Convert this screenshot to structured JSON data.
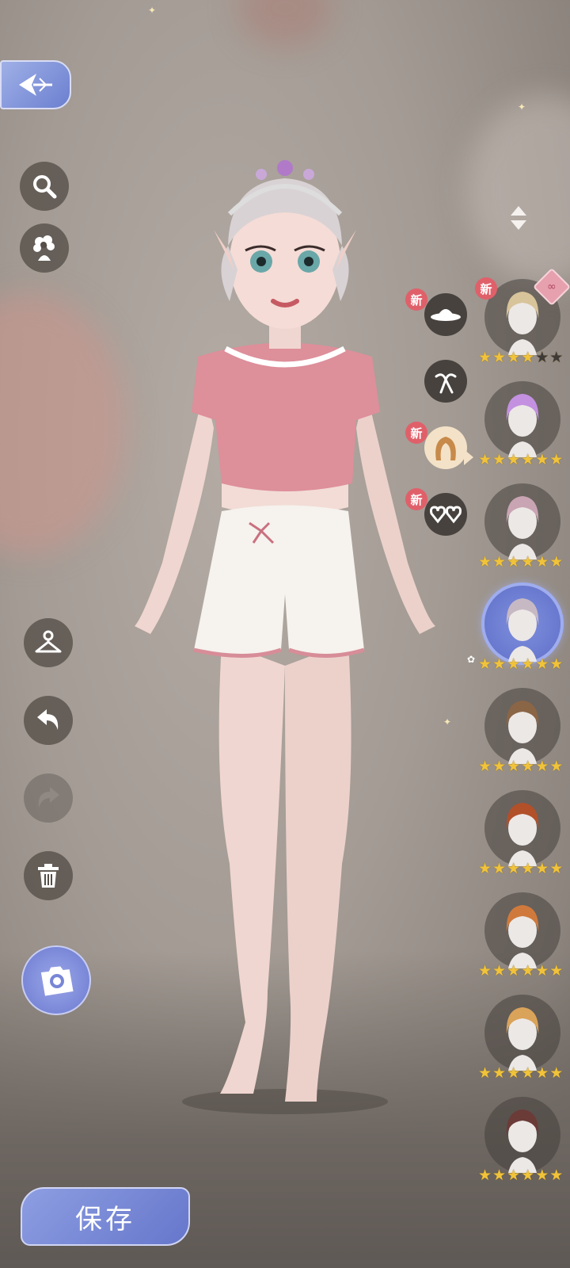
{
  "save_button": {
    "label": "保存"
  },
  "accent_color": "#6c7ad0",
  "new_badge_label": "新",
  "left_tools": [
    {
      "name": "search",
      "icon": "magnifier-icon"
    },
    {
      "name": "theme",
      "icon": "flower-head-icon"
    }
  ],
  "bottom_tools": [
    {
      "name": "outfit",
      "icon": "hanger-icon"
    },
    {
      "name": "undo",
      "icon": "undo-icon"
    },
    {
      "name": "redo",
      "icon": "redo-icon",
      "disabled": true
    },
    {
      "name": "delete",
      "icon": "trash-icon"
    },
    {
      "name": "camera",
      "icon": "camera-icon"
    }
  ],
  "categories": [
    {
      "name": "hat",
      "icon": "hat-icon",
      "new": true
    },
    {
      "name": "hair-accessory",
      "icon": "ribbon-icon",
      "new": false
    },
    {
      "name": "hair",
      "icon": "hair-icon",
      "new": true,
      "active": true
    },
    {
      "name": "glasses",
      "icon": "heart-glasses-icon",
      "new": true
    }
  ],
  "hair_items": [
    {
      "stars": 4,
      "new": true,
      "pinned": true,
      "hair_color": "#d8c49a"
    },
    {
      "stars": 6,
      "hair_color": "#c391e0"
    },
    {
      "stars": 6,
      "hair_color": "#c9a4b3"
    },
    {
      "stars": 6,
      "hair_color": "#c7b9c4",
      "selected": true
    },
    {
      "stars": 6,
      "hair_color": "#8a6546"
    },
    {
      "stars": 6,
      "hair_color": "#b2502a"
    },
    {
      "stars": 6,
      "hair_color": "#cf7a3c"
    },
    {
      "stars": 6,
      "hair_color": "#d9a35a"
    },
    {
      "stars": 6,
      "hair_color": "#6b3b38"
    }
  ]
}
